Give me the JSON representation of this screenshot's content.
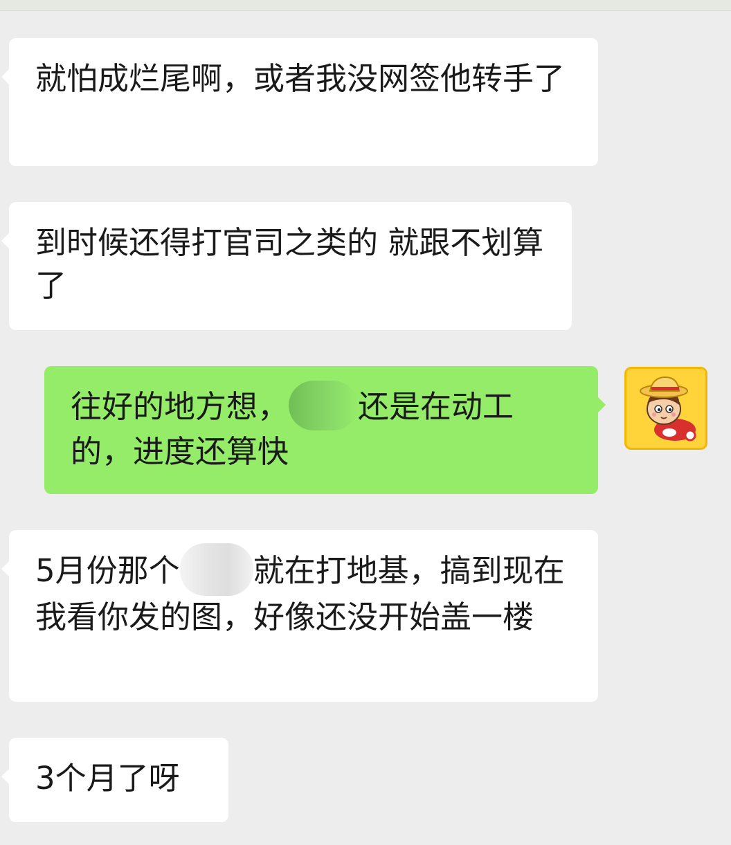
{
  "messages": [
    {
      "id": "m1",
      "direction": "incoming",
      "text": "就怕成烂尾啊，或者我没网签他转手了"
    },
    {
      "id": "m2",
      "direction": "incoming",
      "text": "到时候还得打官司之类的 就跟不划算了"
    },
    {
      "id": "m3",
      "direction": "outgoing",
      "text_before": "往好的地方想，",
      "text_after": "还是在动工的，进度还算快"
    },
    {
      "id": "m4",
      "direction": "incoming",
      "text_before": "5月份那个",
      "text_after": "就在打地基，搞到现在我看你发的图，好像还没开始盖一楼"
    },
    {
      "id": "m5",
      "direction": "incoming",
      "text": "3个月了呀"
    }
  ],
  "colors": {
    "background": "#ededed",
    "incoming_bubble": "#ffffff",
    "outgoing_bubble": "#95ec69",
    "text": "#1a1a1a"
  },
  "avatar": {
    "icon": "cartoon-boy-avatar-icon"
  }
}
